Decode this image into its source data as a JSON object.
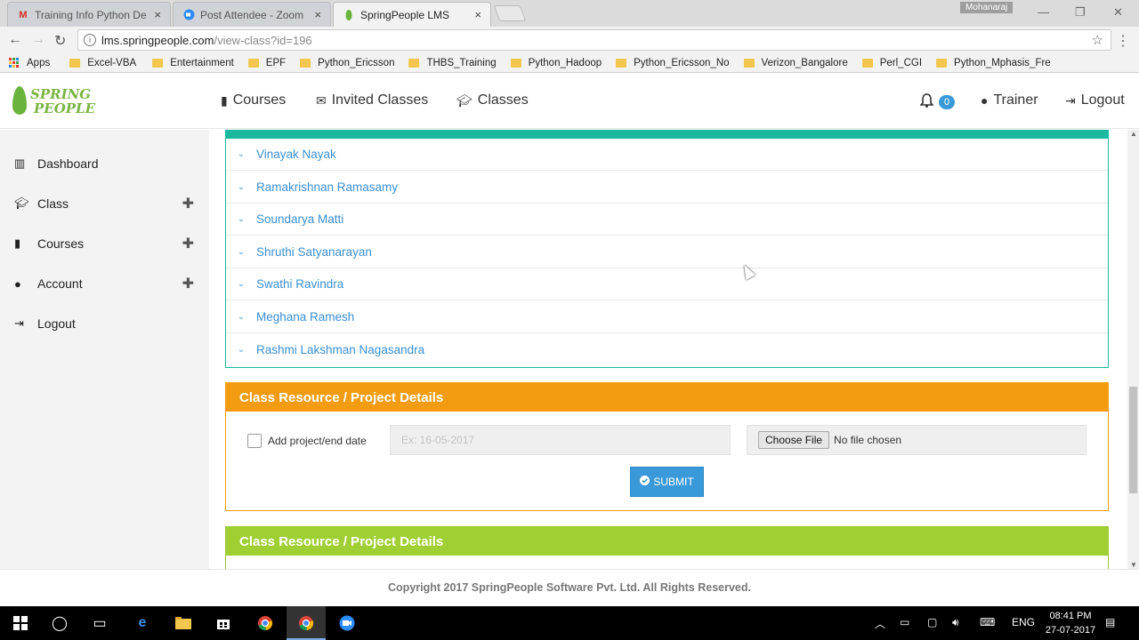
{
  "browser": {
    "tabs": [
      {
        "label": "Training Info Python De",
        "icon": "gmail-icon"
      },
      {
        "label": "Post Attendee - Zoom",
        "icon": "zoom-icon"
      },
      {
        "label": "SpringPeople LMS",
        "icon": "springpeople-leaf-icon"
      }
    ],
    "user": "Mohanaraj",
    "url_host": "lms.springpeople.com",
    "url_path": "/view-class?id=196",
    "bookmarks": [
      "Apps",
      "Excel-VBA",
      "Entertainment",
      "EPF",
      "Python_Ericsson",
      "THBS_Training",
      "Python_Hadoop",
      "Python_Ericsson_No",
      "Verizon_Bangalore",
      "Perl_CGI",
      "Python_Mphasis_Fre"
    ]
  },
  "header": {
    "logo_line1": "SPRING",
    "logo_line2": "PEOPLE",
    "nav": [
      "Courses",
      "Invited Classes",
      "Classes"
    ],
    "notification_count": "0",
    "user_label": "Trainer",
    "logout_label": "Logout"
  },
  "sidebar": {
    "items": [
      {
        "label": "Dashboard",
        "icon": "bar-chart-icon",
        "expandable": false
      },
      {
        "label": "Class",
        "icon": "graduation-cap-icon",
        "expandable": true
      },
      {
        "label": "Courses",
        "icon": "book-icon",
        "expandable": true
      },
      {
        "label": "Account",
        "icon": "user-icon",
        "expandable": true
      },
      {
        "label": "Logout",
        "icon": "sign-out-icon",
        "expandable": false
      }
    ]
  },
  "attendees": [
    "Vinayak Nayak",
    "Ramakrishnan Ramasamy",
    "Soundarya Matti",
    "Shruthi Satyanarayan",
    "Swathi Ravindra",
    "Meghana Ramesh",
    "Rashmi Lakshman Nagasandra"
  ],
  "resource_form": {
    "title": "Class Resource / Project Details",
    "checkbox_label": "Add project/end date",
    "date_placeholder": "Ex: 16-05-2017",
    "choose_file_label": "Choose File",
    "file_status": "No file chosen",
    "submit_label": "SUBMIT"
  },
  "resource_list": {
    "title": "Class Resource / Project Details"
  },
  "footer": {
    "text": "Copyright 2017 SpringPeople Software Pvt. Ltd. All Rights Reserved."
  },
  "taskbar": {
    "language": "ENG",
    "time": "08:41 PM",
    "date": "27-07-2017"
  },
  "colors": {
    "teal": "#1ab99f",
    "orange": "#f39c12",
    "green": "#a0cf34",
    "link": "#3a8fd1",
    "button": "#3a9ad9"
  }
}
